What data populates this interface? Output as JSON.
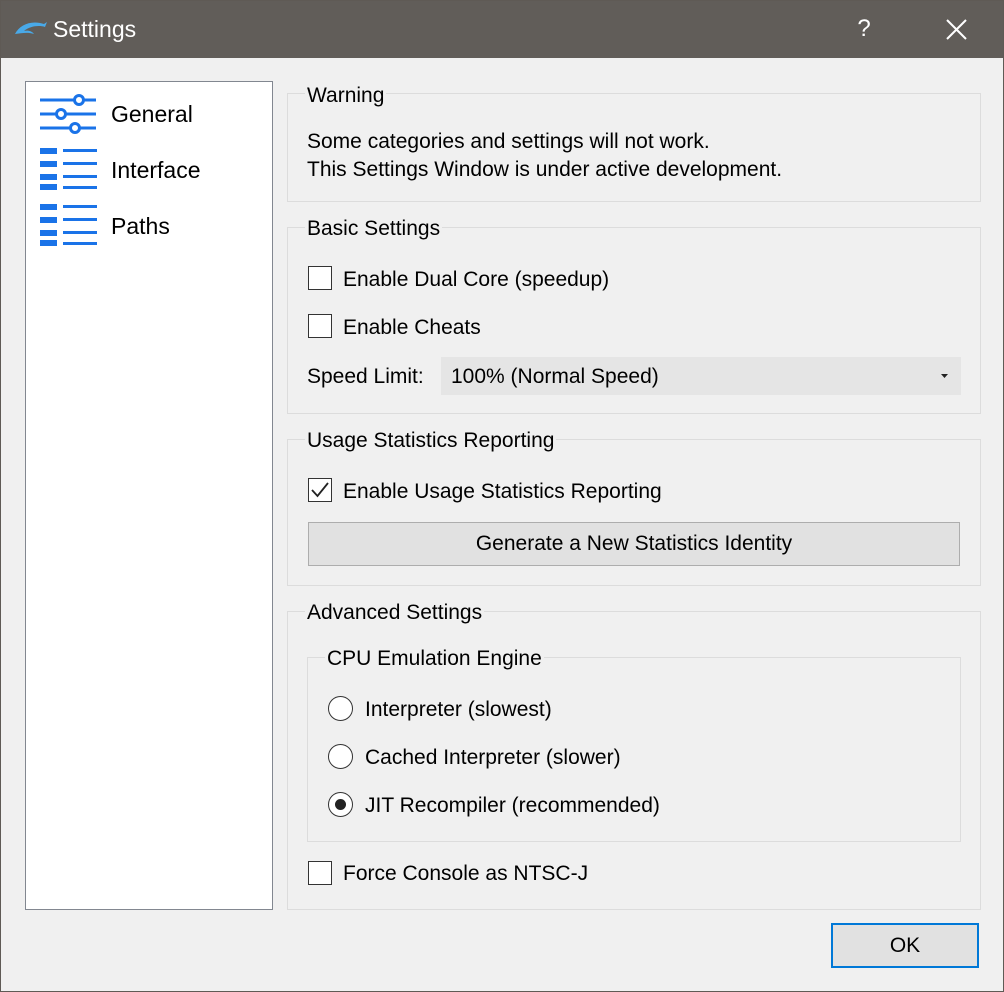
{
  "window": {
    "title": "Settings",
    "help_label": "?"
  },
  "sidebar": {
    "items": [
      {
        "label": "General",
        "icon": "sliders-icon"
      },
      {
        "label": "Interface",
        "icon": "list-icon"
      },
      {
        "label": "Paths",
        "icon": "list-icon"
      }
    ]
  },
  "warning": {
    "title": "Warning",
    "line1": "Some categories and settings will not work.",
    "line2": "This Settings Window is under active development."
  },
  "basic": {
    "title": "Basic Settings",
    "dual_core_label": "Enable Dual Core (speedup)",
    "dual_core_checked": false,
    "cheats_label": "Enable Cheats",
    "cheats_checked": false,
    "speed_limit_label": "Speed Limit:",
    "speed_limit_value": "100% (Normal Speed)"
  },
  "usage": {
    "title": "Usage Statistics Reporting",
    "enable_label": "Enable Usage Statistics Reporting",
    "enable_checked": true,
    "generate_button": "Generate a New Statistics Identity"
  },
  "advanced": {
    "title": "Advanced Settings",
    "cpu_engine_title": "CPU Emulation Engine",
    "engines": [
      {
        "label": "Interpreter (slowest)",
        "selected": false
      },
      {
        "label": "Cached Interpreter (slower)",
        "selected": false
      },
      {
        "label": "JIT Recompiler (recommended)",
        "selected": true
      }
    ],
    "ntsc_label": "Force Console as NTSC-J",
    "ntsc_checked": false
  },
  "footer": {
    "ok_label": "OK"
  },
  "colors": {
    "titlebar": "#615d59",
    "accent": "#0078d7",
    "icon_blue": "#1a73e8"
  }
}
